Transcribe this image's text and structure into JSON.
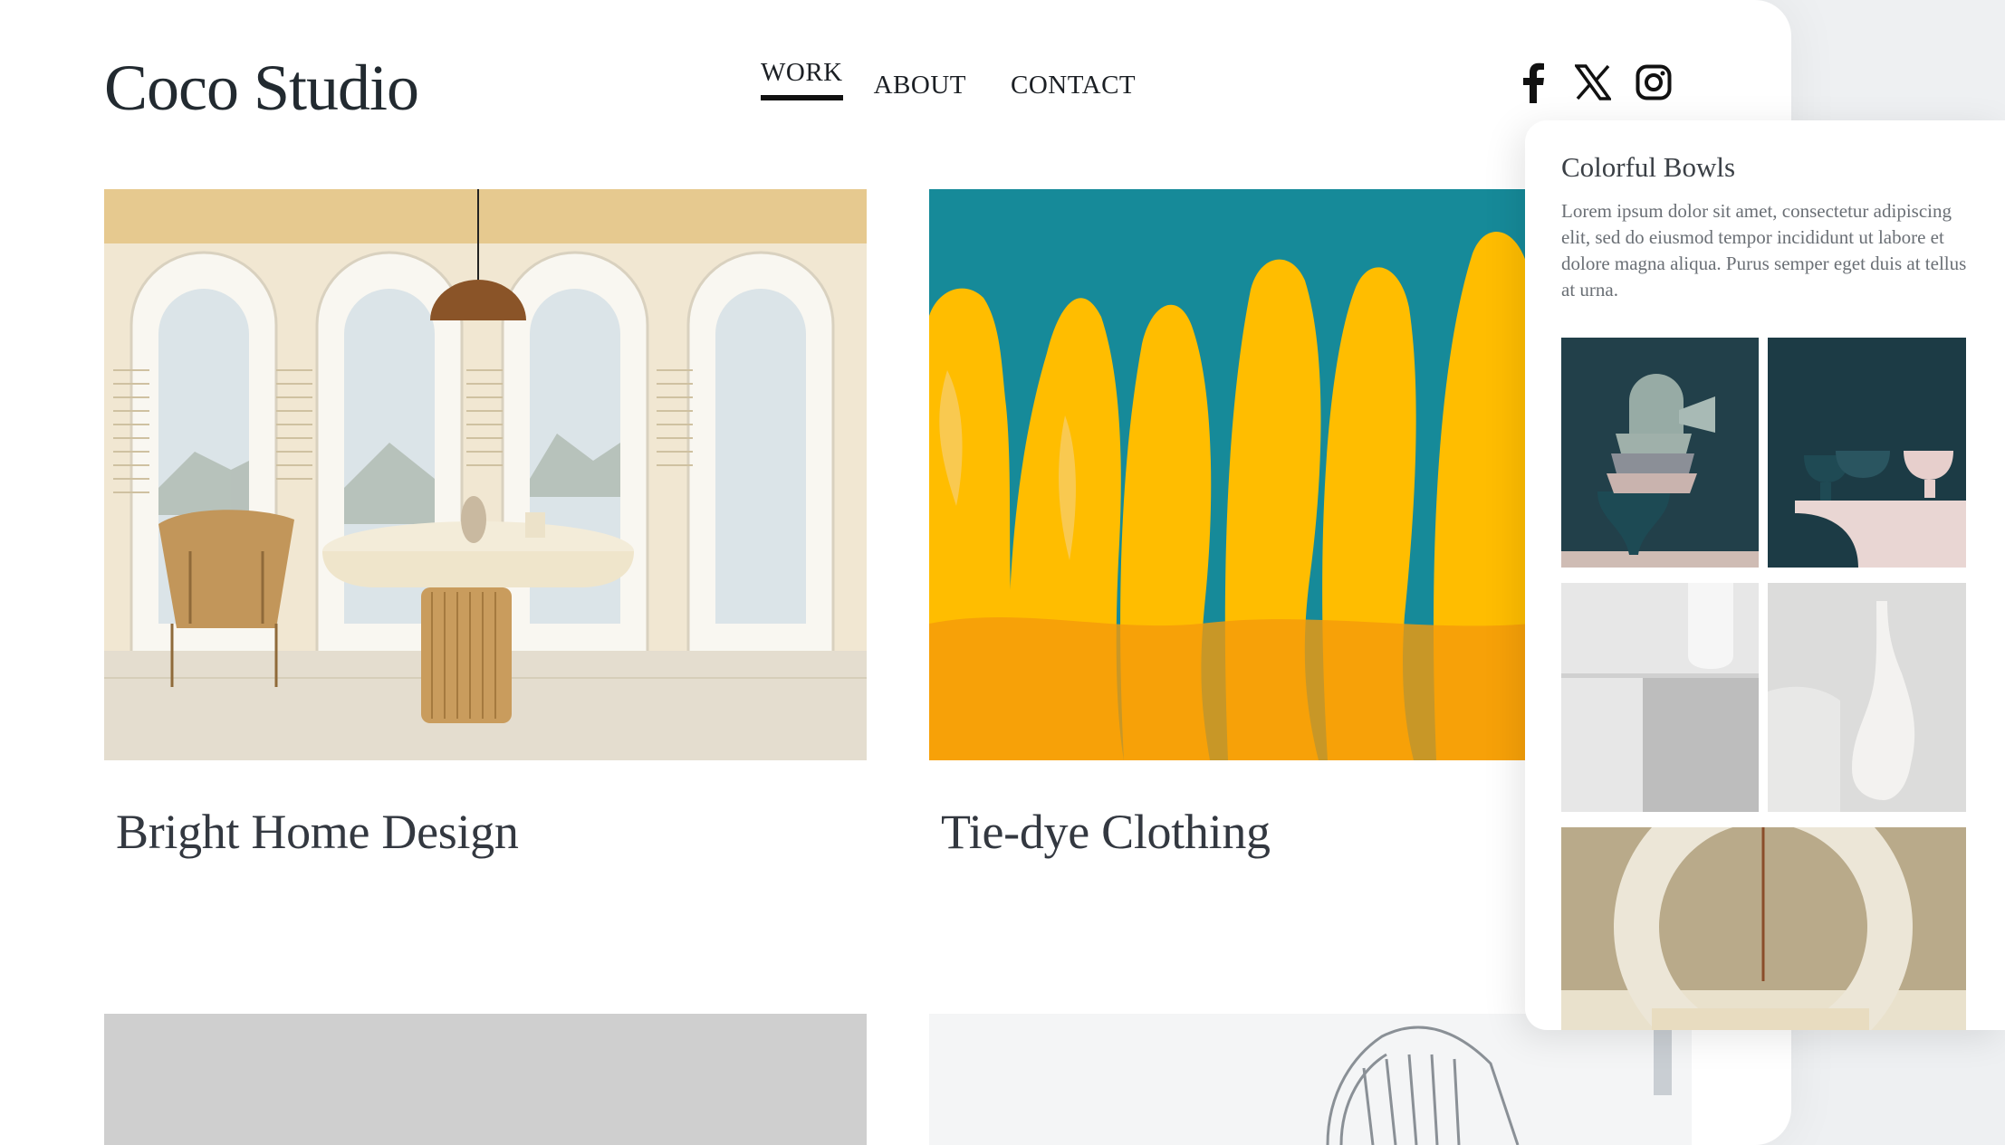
{
  "brand": {
    "name": "Coco Studio"
  },
  "nav": {
    "work": "WORK",
    "about": "ABOUT",
    "contact": "CONTACT"
  },
  "social": {
    "icons": [
      "facebook-icon",
      "x-icon",
      "instagram-icon"
    ]
  },
  "projects": [
    {
      "title": "Bright Home Design"
    },
    {
      "title": "Tie-dye Clothing"
    }
  ],
  "detail_panel": {
    "title": "Colorful Bowls",
    "body": "Lorem ipsum dolor sit amet, consectetur adipiscing elit, sed do eiusmod tempor incididunt ut labore et dolore magna aliqua. Purus semper eget duis at tellus at urna."
  },
  "colors": {
    "text_dark": "#222a30",
    "nav_underline": "#111111",
    "teal": "#168a99",
    "yellow": "#ffbd00",
    "panel_bg": "#ffffff"
  }
}
